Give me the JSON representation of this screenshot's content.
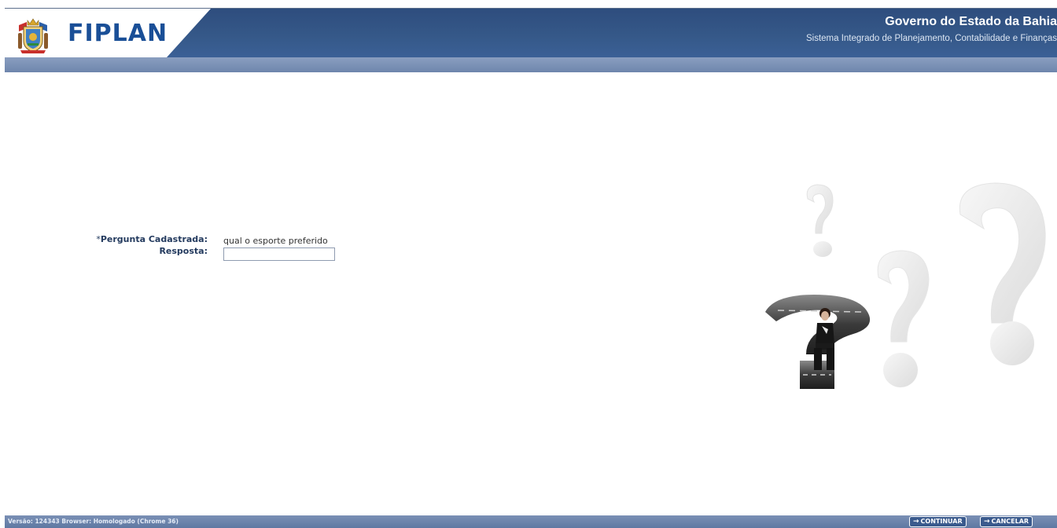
{
  "header": {
    "logo_text": "FIPLAN",
    "title": "Governo do Estado da Bahia",
    "subtitle": "Sistema Integrado de Planejamento, Contabilidade e Finanças"
  },
  "form": {
    "question_label_star": "*",
    "question_label": "Pergunta Cadastrada:",
    "question_value": "qual o esporte preferido",
    "answer_label": "Resposta:",
    "answer_value": ""
  },
  "footer": {
    "version_text": "Versão: 124343   Browser: Homologado (Chrome 36)",
    "continue_label": "CONTINUAR",
    "cancel_label": "CANCELAR",
    "arrow_glyph": "→"
  },
  "colors": {
    "header_band": "#355888",
    "logo_blue": "#1a4f97",
    "label_navy": "#233a5e",
    "footer_bar": "#6e86ad"
  },
  "icons": {
    "crest": "bahia-coat-of-arms-icon",
    "illustration": "question-marks-illustration"
  }
}
